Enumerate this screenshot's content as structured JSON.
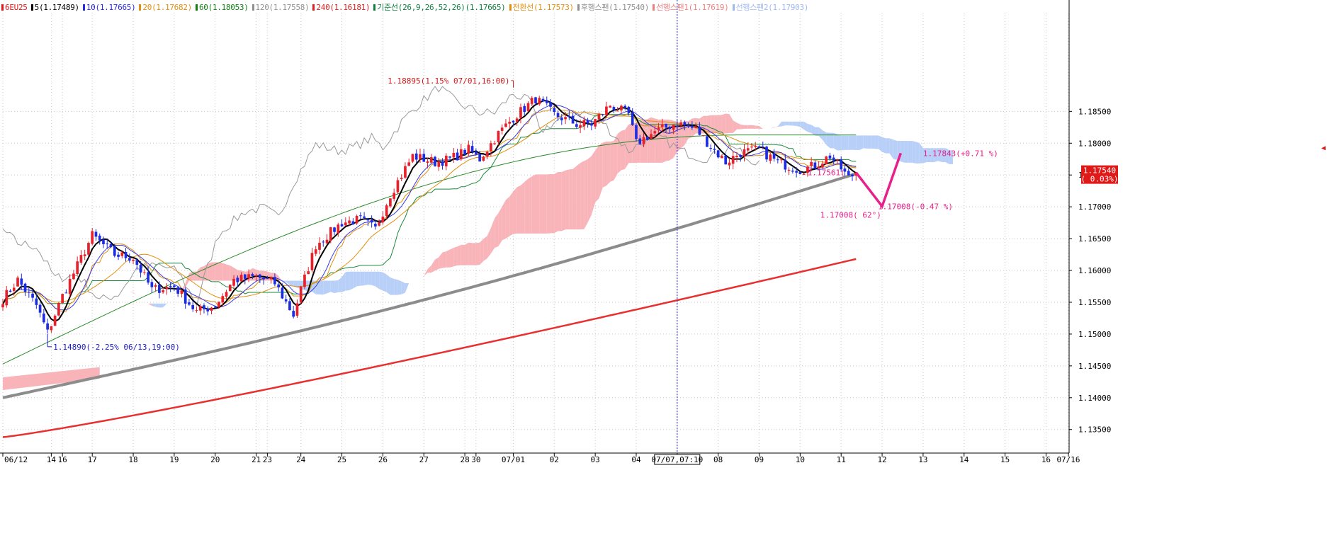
{
  "legend": [
    {
      "label": "6EU25",
      "color": "#e01818"
    },
    {
      "label": "5(1.17489)",
      "color": "#000000"
    },
    {
      "label": "10(1.17665)",
      "color": "#2a2ae0"
    },
    {
      "label": "20(1.17682)",
      "color": "#e09010"
    },
    {
      "label": "60(1.18053)",
      "color": "#108010"
    },
    {
      "label": "120(1.17558)",
      "color": "#909090"
    },
    {
      "label": "240(1.16181)",
      "color": "#e02020"
    },
    {
      "label": "기준선(26,9,26,52,26)(1.17665)",
      "color": "#108040"
    },
    {
      "label": "전환선(1.17573)",
      "color": "#e09010"
    },
    {
      "label": "후행스팬(1.17540)",
      "color": "#909090"
    },
    {
      "label": "선행스팬1(1.17619)",
      "color": "#f08080"
    },
    {
      "label": "선행스팬2(1.17903)",
      "color": "#a0b8f0"
    }
  ],
  "colors": {
    "up": "#e8202c",
    "down": "#1c2ce0",
    "ma5": "#000000",
    "ma10": "#3a3ae8",
    "ma20": "#e09010",
    "ma60": "#2a8a2a",
    "ma120": "#8c8c8c",
    "ma240": "#e83030",
    "kijun": "#1a8a3a",
    "tenkan": "#e09010",
    "chikou": "#9a9a9a",
    "cloud_bull": "#f8b4b8",
    "cloud_bear": "#b8d0f8",
    "annotation": "#e8208a",
    "price_box": "#e01818",
    "grid": "#c8c8c8",
    "cursor": "#2020c0"
  },
  "chart_data": {
    "type": "candlestick",
    "symbol": "6EU25",
    "yticks": [
      "1.13500",
      "1.14000",
      "1.14500",
      "1.15000",
      "1.15500",
      "1.16000",
      "1.16500",
      "1.17000",
      "1.17500",
      "1.18000",
      "1.18500"
    ],
    "ylim": [
      1.1313,
      1.2005
    ],
    "xticks": [
      {
        "i": 0,
        "label": "06/12"
      },
      {
        "i": 13,
        "label": "14"
      },
      {
        "i": 16,
        "label": "16"
      },
      {
        "i": 24,
        "label": "17"
      },
      {
        "i": 35,
        "label": "18"
      },
      {
        "i": 46,
        "label": "19"
      },
      {
        "i": 57,
        "label": "20"
      },
      {
        "i": 68,
        "label": "21"
      },
      {
        "i": 71,
        "label": "23"
      },
      {
        "i": 80,
        "label": "24"
      },
      {
        "i": 91,
        "label": "25"
      },
      {
        "i": 102,
        "label": "26"
      },
      {
        "i": 113,
        "label": "27"
      },
      {
        "i": 124,
        "label": "28"
      },
      {
        "i": 127,
        "label": "30"
      },
      {
        "i": 137,
        "label": "07/01"
      },
      {
        "i": 148,
        "label": "02"
      },
      {
        "i": 159,
        "label": "03"
      },
      {
        "i": 170,
        "label": "04"
      },
      {
        "i": 181,
        "label": "07/07,07:10"
      },
      {
        "i": 192,
        "label": "08"
      },
      {
        "i": 203,
        "label": "09"
      },
      {
        "i": 214,
        "label": "10"
      },
      {
        "i": 225,
        "label": "11"
      },
      {
        "i": 236,
        "label": "12"
      },
      {
        "i": 247,
        "label": "13"
      },
      {
        "i": 258,
        "label": "14"
      },
      {
        "i": 269,
        "label": "15"
      },
      {
        "i": 280,
        "label": "16"
      },
      {
        "i": 286,
        "label": "07/16"
      }
    ],
    "cursor_index": 181,
    "last_price": "1.17540",
    "last_change": "( 0.03%)",
    "anchors": [
      [
        0,
        1.1555
      ],
      [
        4,
        1.1585
      ],
      [
        9,
        1.1545
      ],
      [
        12,
        1.1502
      ],
      [
        16,
        1.156
      ],
      [
        24,
        1.1655
      ],
      [
        30,
        1.1625
      ],
      [
        35,
        1.162
      ],
      [
        40,
        1.157
      ],
      [
        46,
        1.1575
      ],
      [
        52,
        1.1535
      ],
      [
        57,
        1.1545
      ],
      [
        62,
        1.1585
      ],
      [
        68,
        1.159
      ],
      [
        73,
        1.158
      ],
      [
        78,
        1.153
      ],
      [
        80,
        1.157
      ],
      [
        84,
        1.164
      ],
      [
        91,
        1.1675
      ],
      [
        96,
        1.168
      ],
      [
        100,
        1.1665
      ],
      [
        104,
        1.172
      ],
      [
        110,
        1.178
      ],
      [
        116,
        1.177
      ],
      [
        120,
        1.1775
      ],
      [
        125,
        1.179
      ],
      [
        128,
        1.1775
      ],
      [
        133,
        1.1815
      ],
      [
        137,
        1.184
      ],
      [
        143,
        1.187
      ],
      [
        148,
        1.1845
      ],
      [
        154,
        1.183
      ],
      [
        158,
        1.183
      ],
      [
        163,
        1.186
      ],
      [
        168,
        1.1845
      ],
      [
        170,
        1.18
      ],
      [
        175,
        1.1818
      ],
      [
        181,
        1.1832
      ],
      [
        186,
        1.1822
      ],
      [
        190,
        1.1795
      ],
      [
        194,
        1.177
      ],
      [
        198,
        1.1785
      ],
      [
        203,
        1.179
      ],
      [
        208,
        1.177
      ],
      [
        214,
        1.1758
      ],
      [
        218,
        1.1765
      ],
      [
        222,
        1.178
      ],
      [
        225,
        1.176
      ],
      [
        227,
        1.1745
      ],
      [
        229,
        1.1754
      ]
    ],
    "annotations": [
      {
        "i": 137,
        "price": 1.18895,
        "text": "1.18895(1.15% 07/01,16:00)"
      },
      {
        "i": 12,
        "price": 1.1489,
        "text": "1.14890(-2.25% 06/13,19:00)"
      },
      {
        "i": 227,
        "price": 1.17561,
        "text": "1.17561("
      },
      {
        "i": 227,
        "price": 1.17008,
        "text": "1.17008( 62°)"
      },
      {
        "i": 236,
        "price": 1.17008,
        "text": "1.17008(-0.47 %)"
      },
      {
        "i": 247,
        "price": 1.17843,
        "text": "1.17843(+0.71 %)"
      }
    ]
  }
}
